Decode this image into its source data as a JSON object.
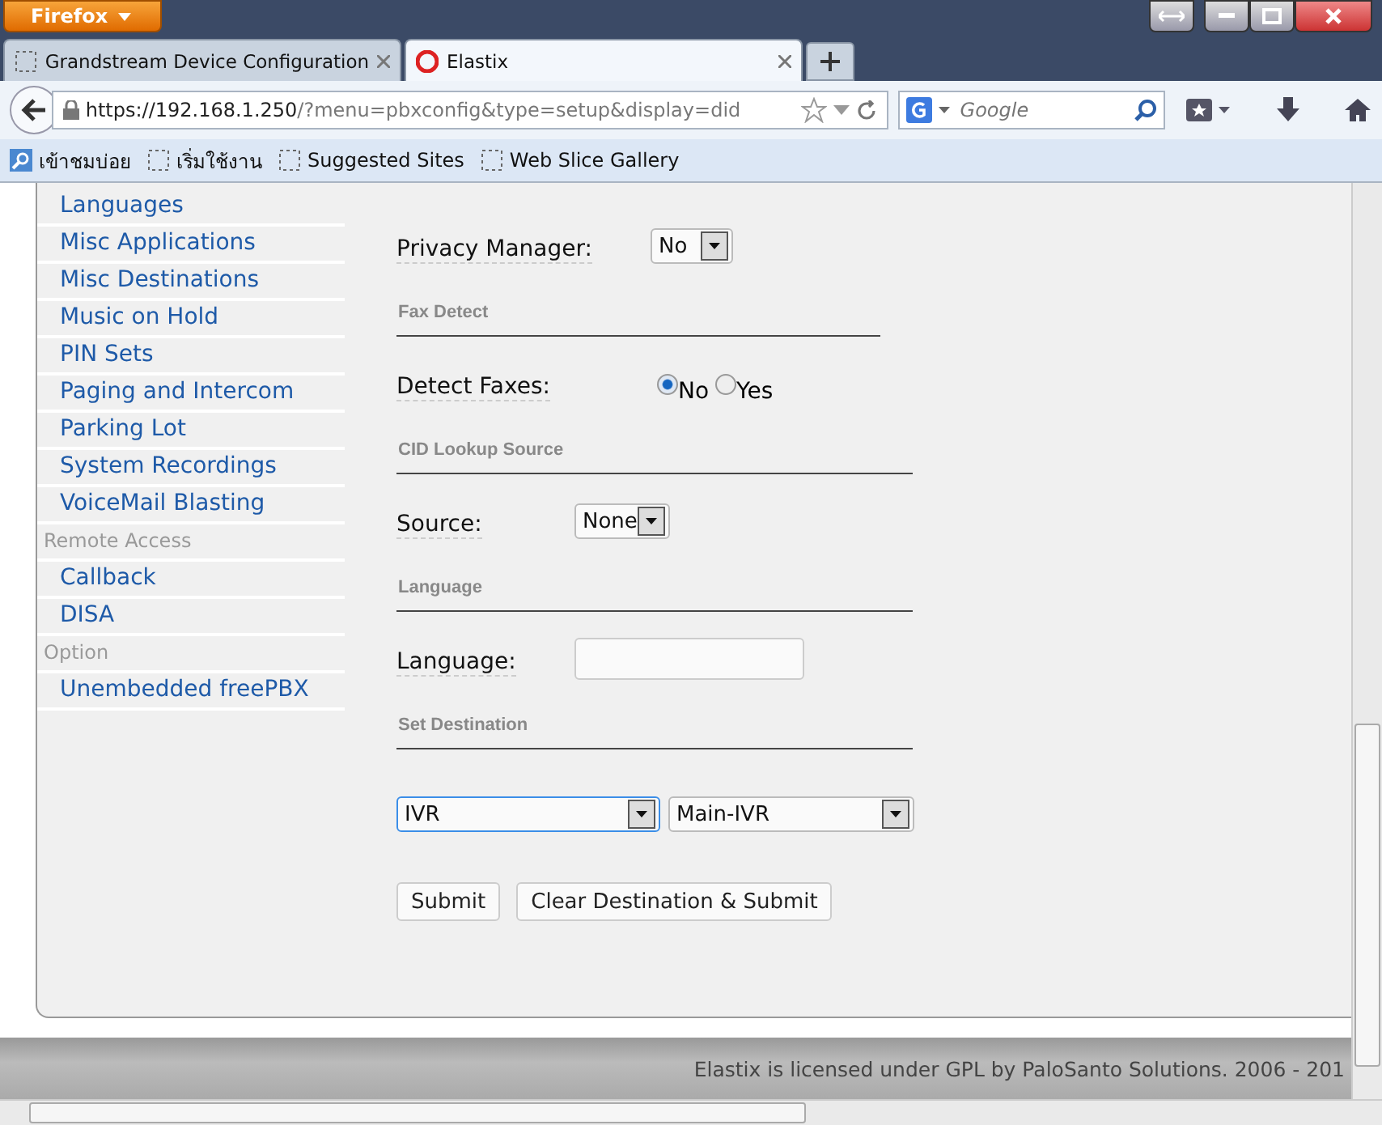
{
  "browser": {
    "menu_button": "Firefox",
    "tabs": [
      {
        "label": "Grandstream Device Configuration",
        "selected": false
      },
      {
        "label": "Elastix",
        "selected": true
      }
    ],
    "url_host": "https://192.168.1.250",
    "url_path": "/?menu=pbxconfig&type=setup&display=did",
    "search_placeholder": "Google",
    "bookmarks": [
      "เข้าชมบ่อย",
      "เริ่มใช้งาน",
      "Suggested Sites",
      "Web Slice Gallery"
    ]
  },
  "sidebar": {
    "items": [
      {
        "kind": "link",
        "label": "Languages"
      },
      {
        "kind": "link",
        "label": "Misc Applications"
      },
      {
        "kind": "link",
        "label": "Misc Destinations"
      },
      {
        "kind": "link",
        "label": "Music on Hold"
      },
      {
        "kind": "link",
        "label": "PIN Sets"
      },
      {
        "kind": "link",
        "label": "Paging and Intercom"
      },
      {
        "kind": "link",
        "label": "Parking Lot"
      },
      {
        "kind": "link",
        "label": "System Recordings"
      },
      {
        "kind": "link",
        "label": "VoiceMail Blasting"
      },
      {
        "kind": "header",
        "label": "Remote Access"
      },
      {
        "kind": "link",
        "label": "Callback"
      },
      {
        "kind": "link",
        "label": "DISA"
      },
      {
        "kind": "header",
        "label": "Option"
      },
      {
        "kind": "link",
        "label": "Unembedded freePBX"
      }
    ]
  },
  "form": {
    "rows": [
      {
        "kind": "select",
        "label": "Privacy Manager:",
        "value": "No"
      },
      {
        "kind": "section",
        "label": "Fax Detect"
      },
      {
        "kind": "radio",
        "label": "Detect Faxes:",
        "options": [
          {
            "label": "No",
            "selected": true
          },
          {
            "label": "Yes",
            "selected": false
          }
        ]
      },
      {
        "kind": "section",
        "label": "CID Lookup Source"
      },
      {
        "kind": "select",
        "label": "Source:",
        "value": "None"
      },
      {
        "kind": "section",
        "label": "Language"
      },
      {
        "kind": "text",
        "label": "Language:",
        "value": ""
      },
      {
        "kind": "section",
        "label": "Set Destination"
      },
      {
        "kind": "destination",
        "selects": [
          {
            "value": "IVR",
            "focused": true
          },
          {
            "value": "Main-IVR",
            "focused": false
          }
        ]
      },
      {
        "kind": "buttons",
        "buttons": [
          "Submit",
          "Clear Destination & Submit"
        ]
      }
    ]
  },
  "footer": "Elastix is licensed under GPL by PaloSanto Solutions. 2006 - 201"
}
